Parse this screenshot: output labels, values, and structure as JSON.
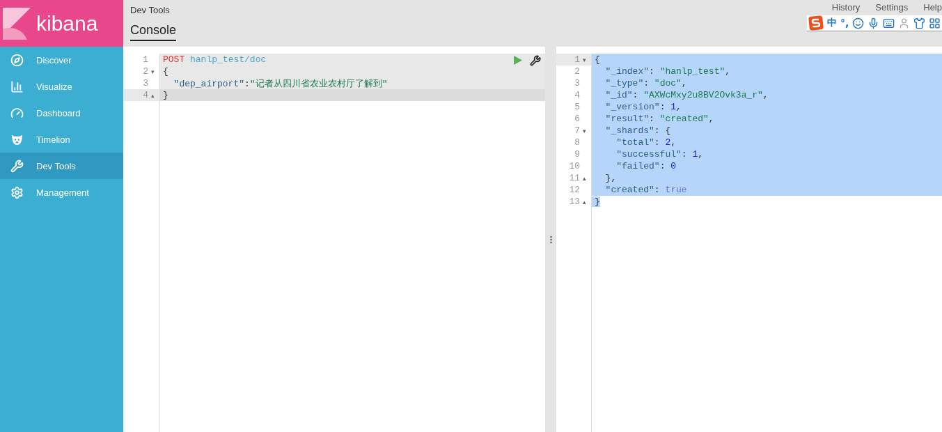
{
  "app": {
    "name": "kibana"
  },
  "sidebar": {
    "items": [
      {
        "label": "Discover",
        "selected": false
      },
      {
        "label": "Visualize",
        "selected": false
      },
      {
        "label": "Dashboard",
        "selected": false
      },
      {
        "label": "Timelion",
        "selected": false
      },
      {
        "label": "Dev Tools",
        "selected": true
      },
      {
        "label": "Management",
        "selected": false
      }
    ]
  },
  "header": {
    "title": "Dev Tools",
    "links": [
      "History",
      "Settings",
      "Help"
    ],
    "tabs": [
      {
        "label": "Console",
        "selected": true
      }
    ]
  },
  "ime_toolbar": {
    "items": [
      "中",
      "°,"
    ]
  },
  "request_editor": {
    "lines": [
      {
        "number": "1",
        "active": false,
        "tokens": [
          {
            "kind": "keyword",
            "text": "POST"
          },
          {
            "kind": "url",
            "text": " hanlp_test/doc"
          }
        ]
      },
      {
        "number": "2",
        "fold": "▾",
        "active": false,
        "tokens": [
          {
            "kind": "brace",
            "text": "{"
          }
        ]
      },
      {
        "number": "3",
        "active": false,
        "tokens": [
          {
            "kind": "key",
            "text": "  \"dep_airport\""
          },
          {
            "kind": "plain",
            "text": ":"
          },
          {
            "kind": "string",
            "text": "\"记者从四川省农业农村厅了解到\""
          }
        ]
      },
      {
        "number": "4",
        "fold": "▴",
        "active": true,
        "tokens": [
          {
            "kind": "brace",
            "text": "}"
          }
        ]
      }
    ]
  },
  "response_editor": {
    "lines": [
      {
        "number": "1",
        "fold": "▾",
        "active": true,
        "tokens": [
          {
            "kind": "brace",
            "text": "{"
          }
        ]
      },
      {
        "number": "2",
        "active": false,
        "tokens": [
          {
            "kind": "key",
            "text": "  \"_index\""
          },
          {
            "kind": "plain",
            "text": ": "
          },
          {
            "kind": "string",
            "text": "\"hanlp_test\""
          },
          {
            "kind": "plain",
            "text": ","
          }
        ]
      },
      {
        "number": "3",
        "active": false,
        "tokens": [
          {
            "kind": "key",
            "text": "  \"_type\""
          },
          {
            "kind": "plain",
            "text": ": "
          },
          {
            "kind": "string",
            "text": "\"doc\""
          },
          {
            "kind": "plain",
            "text": ","
          }
        ]
      },
      {
        "number": "4",
        "active": false,
        "tokens": [
          {
            "kind": "key",
            "text": "  \"_id\""
          },
          {
            "kind": "plain",
            "text": ": "
          },
          {
            "kind": "string",
            "text": "\"AXWcMxy2u8BV2Ovk3a_r\""
          },
          {
            "kind": "plain",
            "text": ","
          }
        ]
      },
      {
        "number": "5",
        "active": false,
        "tokens": [
          {
            "kind": "key",
            "text": "  \"_version\""
          },
          {
            "kind": "plain",
            "text": ": "
          },
          {
            "kind": "number",
            "text": "1"
          },
          {
            "kind": "plain",
            "text": ","
          }
        ]
      },
      {
        "number": "6",
        "active": false,
        "tokens": [
          {
            "kind": "key",
            "text": "  \"result\""
          },
          {
            "kind": "plain",
            "text": ": "
          },
          {
            "kind": "string",
            "text": "\"created\""
          },
          {
            "kind": "plain",
            "text": ","
          }
        ]
      },
      {
        "number": "7",
        "fold": "▾",
        "active": false,
        "tokens": [
          {
            "kind": "key",
            "text": "  \"_shards\""
          },
          {
            "kind": "plain",
            "text": ": "
          },
          {
            "kind": "brace",
            "text": "{"
          }
        ]
      },
      {
        "number": "8",
        "active": false,
        "tokens": [
          {
            "kind": "key",
            "text": "    \"total\""
          },
          {
            "kind": "plain",
            "text": ": "
          },
          {
            "kind": "number",
            "text": "2"
          },
          {
            "kind": "plain",
            "text": ","
          }
        ]
      },
      {
        "number": "9",
        "active": false,
        "tokens": [
          {
            "kind": "key",
            "text": "    \"successful\""
          },
          {
            "kind": "plain",
            "text": ": "
          },
          {
            "kind": "number",
            "text": "1"
          },
          {
            "kind": "plain",
            "text": ","
          }
        ]
      },
      {
        "number": "10",
        "active": false,
        "tokens": [
          {
            "kind": "key",
            "text": "    \"failed\""
          },
          {
            "kind": "plain",
            "text": ": "
          },
          {
            "kind": "number",
            "text": "0"
          }
        ]
      },
      {
        "number": "11",
        "fold": "▴",
        "active": false,
        "tokens": [
          {
            "kind": "brace",
            "text": "  }"
          },
          {
            "kind": "plain",
            "text": ","
          }
        ]
      },
      {
        "number": "12",
        "active": false,
        "tokens": [
          {
            "kind": "key",
            "text": "  \"created\""
          },
          {
            "kind": "plain",
            "text": ": "
          },
          {
            "kind": "bool",
            "text": "true"
          }
        ]
      },
      {
        "number": "13",
        "fold": "▴",
        "active": false,
        "tokens": [
          {
            "kind": "brace",
            "text": "}"
          }
        ]
      }
    ]
  }
}
